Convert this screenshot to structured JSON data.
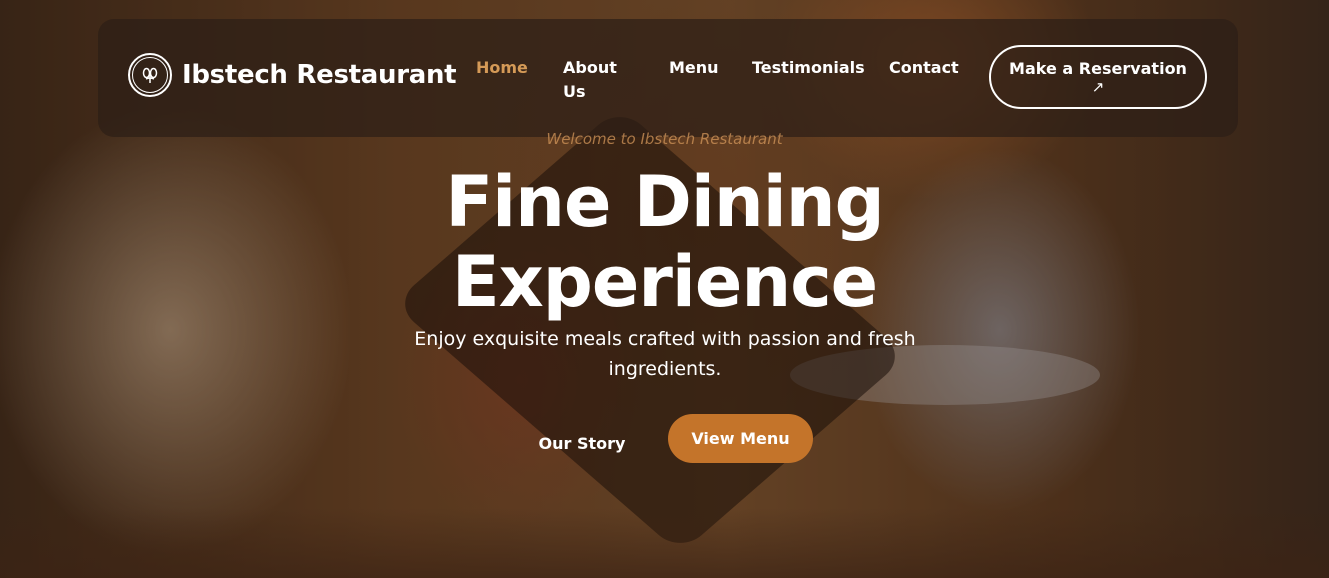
{
  "brand": {
    "name": "Ibstech Restaurant",
    "logo_icon": "leaf-cluster-icon"
  },
  "nav": {
    "items": [
      {
        "label": "Home",
        "active": true
      },
      {
        "label": "About Us",
        "active": false
      },
      {
        "label": "Menu",
        "active": false
      },
      {
        "label": "Testimonials",
        "active": false
      },
      {
        "label": "Contact",
        "active": false
      }
    ],
    "reservation_label": "Make a Reservation",
    "reservation_icon": "arrow-up-right-icon"
  },
  "hero": {
    "eyebrow": "Welcome to Ibstech Restaurant",
    "headline_line1": "Fine Dining",
    "headline_line2": "Experience",
    "subtext": "Enjoy exquisite meals crafted with passion and fresh ingredients.",
    "secondary_cta": "Our Story",
    "primary_cta": "View Menu"
  },
  "colors": {
    "accent": "#d59a57",
    "primary_button": "#c4742a",
    "navbar_bg": "#2d1e16"
  }
}
